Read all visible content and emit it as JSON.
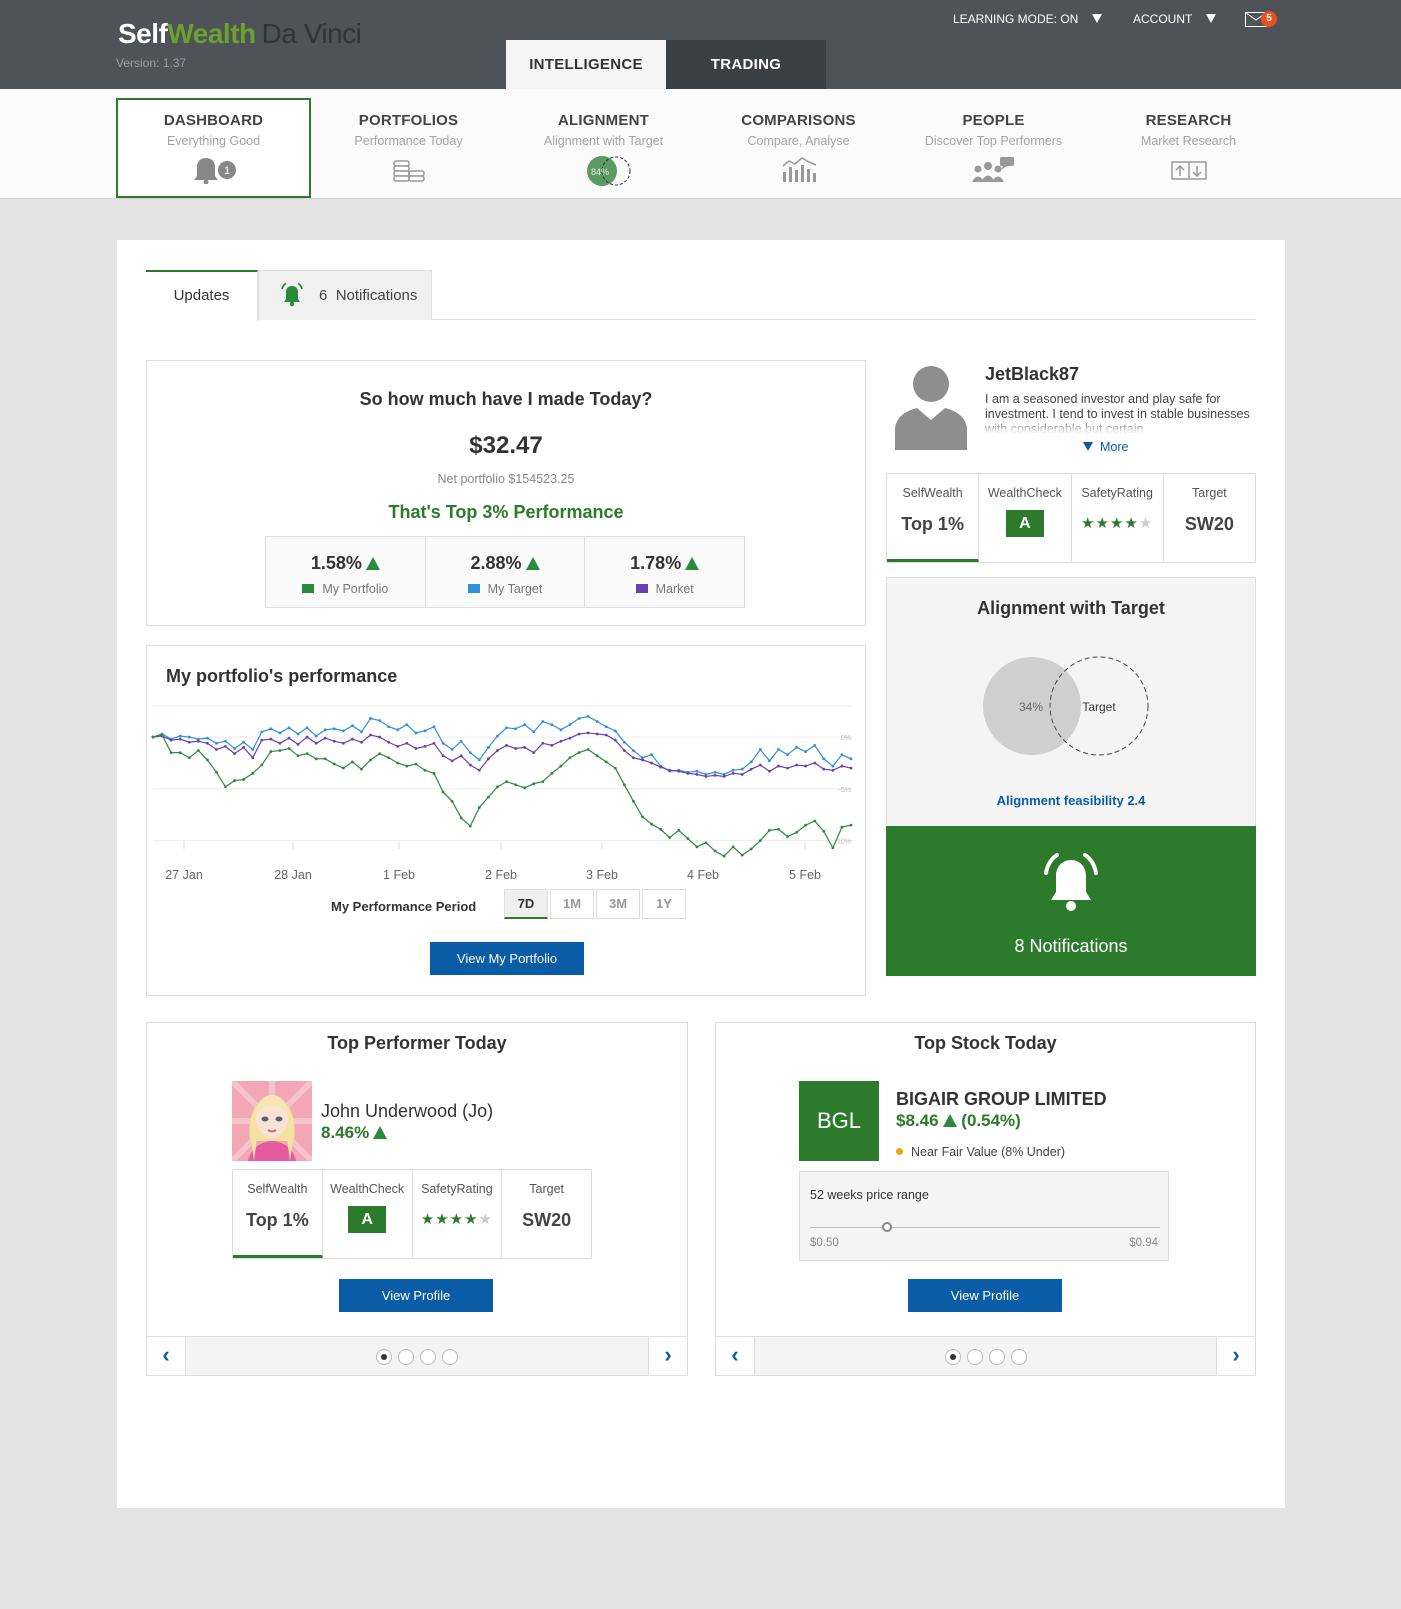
{
  "app": {
    "logo_self": "Self",
    "logo_wealth": "Wealth",
    "logo_product": "Da Vinci",
    "version": "Version: 1.37"
  },
  "top": {
    "learning_mode": "LEARNING MODE: ON",
    "account": "ACCOUNT",
    "mail_count": "5",
    "tabs": [
      {
        "label": "INTELLIGENCE",
        "active": true
      },
      {
        "label": "TRADING",
        "active": false
      }
    ]
  },
  "nav": {
    "items": [
      {
        "title": "DASHBOARD",
        "subtitle": "Everything Good",
        "icon": "bell-icon",
        "badge": "1"
      },
      {
        "title": "PORTFOLIOS",
        "subtitle": "Performance Today",
        "icon": "coins-icon"
      },
      {
        "title": "ALIGNMENT",
        "subtitle": "Alignment with Target",
        "icon": "alignment-icon",
        "badge": "84%"
      },
      {
        "title": "COMPARISONS",
        "subtitle": "Compare, Analyse",
        "icon": "bar-chart-icon"
      },
      {
        "title": "PEOPLE",
        "subtitle": "Discover Top Performers",
        "icon": "people-icon"
      },
      {
        "title": "RESEARCH",
        "subtitle": "Market Research",
        "icon": "research-icon"
      }
    ]
  },
  "tabs": {
    "updates": "Updates",
    "notifications_count": "6",
    "notifications_label": "Notifications"
  },
  "made_today": {
    "question": "So how much have I made Today?",
    "amount": "$32.47",
    "net": "Net portfolio $154523.25",
    "performance": "That's Top 3% Performance",
    "stats": [
      {
        "value": "1.58%",
        "label": "My Portfolio",
        "color": "#2c8a3c"
      },
      {
        "value": "2.88%",
        "label": "My Target",
        "color": "#2f8fd8"
      },
      {
        "value": "1.78%",
        "label": "Market",
        "color": "#6a3fb0"
      }
    ]
  },
  "performance": {
    "title": "My portfolio's performance",
    "period_label": "My Performance Period",
    "periods": [
      "7D",
      "1M",
      "3M",
      "1Y"
    ],
    "active_period": "7D",
    "button": "View My Portfolio"
  },
  "chart_data": {
    "type": "line",
    "x": [
      "27 Jan",
      "28 Jan",
      "1 Feb",
      "2 Feb",
      "3 Feb",
      "4 Feb",
      "5 Feb"
    ],
    "y_ticks": [
      "0%",
      "-5%",
      "-10%"
    ],
    "ylim": [
      -11,
      3
    ],
    "grid": true,
    "series": [
      {
        "name": "My Target",
        "color": "#2f8fd8",
        "values": [
          0,
          0.3,
          -0.2,
          0.1,
          0,
          -0.2,
          -0.1,
          -0.6,
          -0.4,
          -1.1,
          -0.5,
          -1.2,
          0.5,
          0.8,
          0.4,
          0.9,
          0.3,
          0.9,
          0.1,
          0.7,
          0.8,
          0.6,
          1.1,
          0.5,
          1.8,
          1.6,
          1.0,
          0.7,
          1.2,
          0.4,
          0.6,
          1.0,
          -0.6,
          -1.2,
          -0.4,
          -1.5,
          -2.2,
          -1.0,
          0.1,
          0.9,
          0.8,
          1.2,
          0.5,
          1.5,
          1.2,
          0.7,
          1.2,
          1.8,
          2.0,
          1.5,
          1.0,
          0.6,
          -0.5,
          -1.3,
          -2.0,
          -1.7,
          -2.8,
          -3.3,
          -3.2,
          -3.4,
          -3.3,
          -3.6,
          -3.4,
          -3.6,
          -3.2,
          -3.1,
          -2.4,
          -1.2,
          -2.3,
          -1.2,
          -1.7,
          -1.0,
          -1.4,
          -0.8,
          -2.1,
          -2.8,
          -1.7,
          -2.1
        ]
      },
      {
        "name": "Market",
        "color": "#6a3fb0",
        "values": [
          0,
          0.1,
          -0.3,
          -0.2,
          -0.5,
          -0.4,
          -0.6,
          -1.2,
          -0.9,
          -1.6,
          -1.0,
          -2.0,
          -0.3,
          -0.2,
          -0.6,
          -0.1,
          -0.7,
          0.0,
          -0.6,
          -0.1,
          -0.4,
          -0.6,
          -0.2,
          -0.5,
          0.2,
          0.0,
          -0.5,
          -0.9,
          -0.6,
          -1.1,
          -0.9,
          -0.6,
          -1.8,
          -2.3,
          -1.8,
          -2.7,
          -3.2,
          -2.1,
          -1.3,
          -0.8,
          -1.1,
          -1.0,
          -1.5,
          -0.6,
          -0.8,
          -0.4,
          -0.1,
          0.3,
          0.4,
          0.3,
          0.2,
          -0.3,
          -1.3,
          -2.0,
          -2.2,
          -2.5,
          -2.9,
          -3.2,
          -3.3,
          -3.5,
          -3.6,
          -3.8,
          -3.7,
          -3.8,
          -3.5,
          -3.6,
          -3.1,
          -2.7,
          -3.3,
          -2.8,
          -3.0,
          -2.7,
          -2.8,
          -2.5,
          -3.1,
          -3.2,
          -2.8,
          -3.0
        ]
      },
      {
        "name": "My Portfolio",
        "color": "#2c8a3c",
        "values": [
          0,
          0.2,
          -1.5,
          -1.5,
          -2.0,
          -1.3,
          -2.2,
          -3.4,
          -4.8,
          -4.2,
          -4.1,
          -3.5,
          -2.7,
          -1.4,
          -1.3,
          -1.1,
          -1.8,
          -1.6,
          -2.1,
          -2.1,
          -2.6,
          -3.0,
          -2.4,
          -3.1,
          -2.2,
          -1.6,
          -2.0,
          -2.5,
          -2.8,
          -2.6,
          -3.2,
          -3.5,
          -5.3,
          -6.2,
          -7.8,
          -8.6,
          -6.8,
          -5.8,
          -4.8,
          -4.3,
          -4.6,
          -4.9,
          -4.5,
          -4.3,
          -3.5,
          -2.8,
          -2.0,
          -1.5,
          -1.2,
          -1.8,
          -2.4,
          -3.0,
          -4.6,
          -6.2,
          -7.7,
          -8.4,
          -8.9,
          -9.7,
          -9.0,
          -9.8,
          -10.6,
          -10.2,
          -11.0,
          -11.5,
          -10.6,
          -11.4,
          -10.8,
          -10.0,
          -9.0,
          -8.9,
          -9.6,
          -9.2,
          -8.5,
          -8.1,
          -9.1,
          -10.7,
          -8.7,
          -8.5
        ]
      }
    ]
  },
  "profile": {
    "username": "JetBlack87",
    "bio": "I am a seasoned investor and play safe for investment.  I tend to invest in stable businesses with considerable but certain",
    "more": "More",
    "metrics": [
      {
        "label": "SelfWealth",
        "value": "Top 1%"
      },
      {
        "label": "WealthCheck",
        "value": "A"
      },
      {
        "label": "SafetyRating",
        "stars": 4,
        "max": 5
      },
      {
        "label": "Target",
        "value": "SW20"
      }
    ]
  },
  "alignment": {
    "title": "Alignment with Target",
    "percent": "34%",
    "target_label": "Target",
    "feasibility": "Alignment feasibility 2.4"
  },
  "notifications_card": {
    "label": "8 Notifications"
  },
  "top_performer": {
    "title": "Top Performer Today",
    "name": "John Underwood (Jo)",
    "percent": "8.46%",
    "metrics": [
      {
        "label": "SelfWealth",
        "value": "Top 1%"
      },
      {
        "label": "WealthCheck",
        "value": "A"
      },
      {
        "label": "SafetyRating",
        "stars": 4,
        "max": 5
      },
      {
        "label": "Target",
        "value": "SW20"
      }
    ],
    "button": "View Profile"
  },
  "top_stock": {
    "title": "Top Stock Today",
    "ticker": "BGL",
    "name": "BIGAIR GROUP LIMITED",
    "price": "$8.46",
    "change": "(0.54%)",
    "fair_value": "Near Fair Value (8% Under)",
    "range_title": "52 weeks price range",
    "range_low": "$0.50",
    "range_high": "$0.94",
    "range_position": 0.22,
    "button": "View Profile"
  },
  "carousel": {
    "pages": 4,
    "current": 1,
    "prev": "‹",
    "next": "›"
  }
}
